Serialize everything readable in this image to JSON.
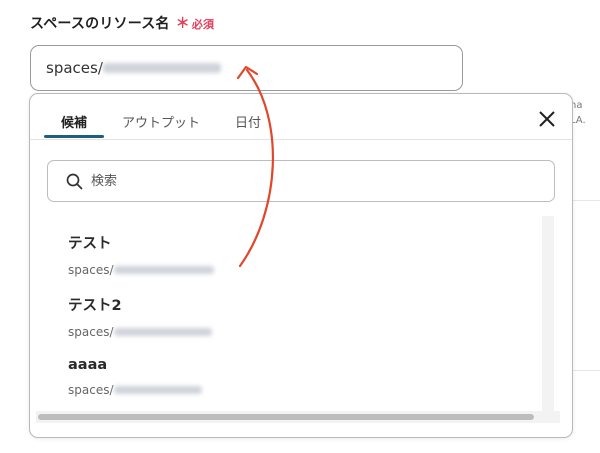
{
  "field": {
    "label": "スペースのリソース名",
    "required_mark": "＊",
    "required_text": "必須",
    "value_prefix": "spaces/"
  },
  "background_clip": {
    "line1": "na",
    "line2": "LA."
  },
  "dropdown": {
    "tabs": [
      {
        "label": "候補",
        "active": true
      },
      {
        "label": "アウトプット",
        "active": false
      },
      {
        "label": "日付",
        "active": false
      }
    ],
    "search": {
      "placeholder": "検索"
    },
    "items": [
      {
        "title": "テスト",
        "subtitle_prefix": "spaces/"
      },
      {
        "title": "テスト2",
        "subtitle_prefix": "spaces/"
      },
      {
        "title": "aaaa",
        "subtitle_prefix": "spaces/"
      }
    ]
  },
  "colors": {
    "required": "#e0405a",
    "tab_underline": "#1f5f7a",
    "annotation_arrow": "#e0482c"
  },
  "icons": [
    "search-icon",
    "close-icon"
  ]
}
